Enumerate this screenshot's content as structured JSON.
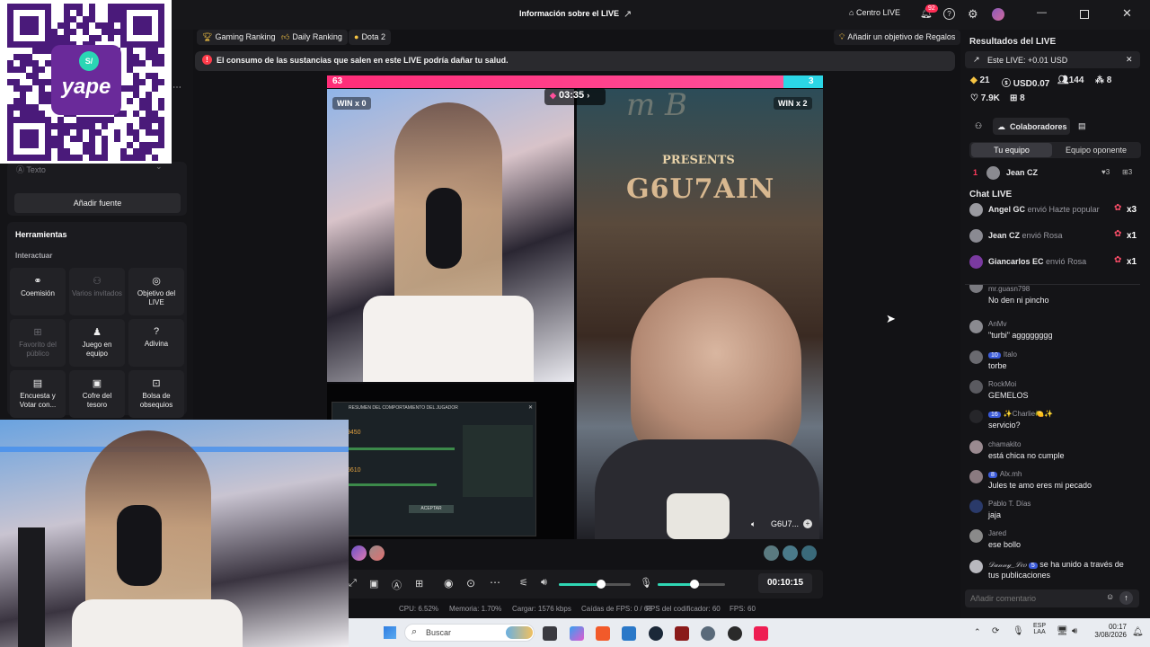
{
  "window": {
    "title": "Información sobre el LIVE",
    "centro_label": "Centro LIVE",
    "notification_count": "92"
  },
  "tags": [
    "Gaming Ranking",
    "Daily Ranking",
    "Dota 2"
  ],
  "goal_button": "Añadir un objetivo de Regalos",
  "warning": "El consumo de las sustancias que salen en este LIVE podría dañar tu salud.",
  "left_panel": {
    "source_item": "Texto",
    "add_source": "Añadir fuente",
    "tools_title": "Herramientas",
    "interact_title": "Interactuar",
    "tools": [
      {
        "label": "Coemisión",
        "icon": "link-icon",
        "enabled": true
      },
      {
        "label": "Varios invitados",
        "icon": "group-icon",
        "enabled": false
      },
      {
        "label": "Objetivo del LIVE",
        "icon": "target-icon",
        "enabled": true
      },
      {
        "label": "Favorito del público",
        "icon": "gift-icon",
        "enabled": false
      },
      {
        "label": "Juego en equipo",
        "icon": "team-icon",
        "enabled": true
      },
      {
        "label": "Adivina",
        "icon": "question-icon",
        "enabled": true
      },
      {
        "label": "Encuesta y Votar con...",
        "icon": "poll-icon",
        "enabled": true
      },
      {
        "label": "Cofre del tesoro",
        "icon": "chest-icon",
        "enabled": true
      },
      {
        "label": "Bolsa de obsequios",
        "icon": "bag-icon",
        "enabled": true
      }
    ]
  },
  "qr_overlay": {
    "brand": "yape",
    "badge": "S/"
  },
  "battle": {
    "left_score": "63",
    "right_score": "3",
    "left_wins": "WIN x 0",
    "right_wins": "WIN x 2",
    "timer": "03:35",
    "right_banner": "PRESENTS",
    "right_banner_name": "G6U7AIN",
    "right_partial": "m B",
    "right_name": "G6U7...",
    "game_panel_title": "RESUMEN DEL COMPORTAMIENTO DEL JUGADOR",
    "game_values": [
      "9450",
      "6610"
    ],
    "game_button": "ACEPTAR"
  },
  "controls": {
    "duration": "00:10:15"
  },
  "stats": {
    "cpu": "CPU: 6.52%",
    "memoria": "Memoria: 1.70%",
    "cargar": "Cargar: 1576 kbps",
    "caidas": "Caídas de FPS: 0 / 68",
    "fps_codificador": "FPS del codificador: 60",
    "fps": "FPS: 60"
  },
  "results": {
    "title": "Resultados del LIVE",
    "live_line": "Este LIVE: +0.01 USD",
    "stat1": "21",
    "stat2": "USD0.07",
    "stat3": "144",
    "stat4": "8",
    "stat5": "7.9K",
    "stat6": "8"
  },
  "collab": {
    "title": "Colaboradores",
    "tab1": "Tu equipo",
    "tab2": "Equipo oponente",
    "rank": "1",
    "name": "Jean CZ",
    "hearts": "3",
    "gifts": "3"
  },
  "chat": {
    "title": "Chat LIVE",
    "gifts": [
      {
        "name": "Angel GC",
        "text": "envió Hazte popular",
        "count": "x3"
      },
      {
        "name": "Jean CZ",
        "text": "envió Rosa",
        "count": "x1"
      },
      {
        "name": "Giancarlos EC",
        "text": "envió Rosa",
        "count": "x1"
      }
    ],
    "messages": [
      {
        "name": "mr.guasn798",
        "badge": "",
        "text": "No den ni pincho"
      },
      {
        "name": "AnMv",
        "badge": "",
        "text": "\"turbi\" agggggggg"
      },
      {
        "name": "Italo",
        "badge": "10",
        "text": "torbe"
      },
      {
        "name": "RockMoi",
        "badge": "",
        "text": "GEMELOS"
      },
      {
        "name": "✨Charlie🍋✨",
        "badge": "16",
        "text": "servicio?"
      },
      {
        "name": "chamakito",
        "badge": "",
        "text": "está chica no cumple"
      },
      {
        "name": "Alx.mh",
        "badge": "8",
        "text": "Jules te amo eres mi pecado"
      },
      {
        "name": "Pablo T. Días",
        "badge": "",
        "text": "jaja"
      },
      {
        "name": "Jared",
        "badge": "",
        "text": "ese bollo"
      }
    ],
    "join": {
      "name": "𝒟𝒶𝓃𝓃𝓎_ℒ𝑒𝑜",
      "badge": "5",
      "text": "se ha unido a través de tus publicaciones"
    },
    "placeholder": "Añadir comentario"
  },
  "taskbar": {
    "search": "Buscar",
    "lang1": "ESP",
    "lang2": "LAA",
    "time": "00:17",
    "date": "3/08/2026"
  }
}
